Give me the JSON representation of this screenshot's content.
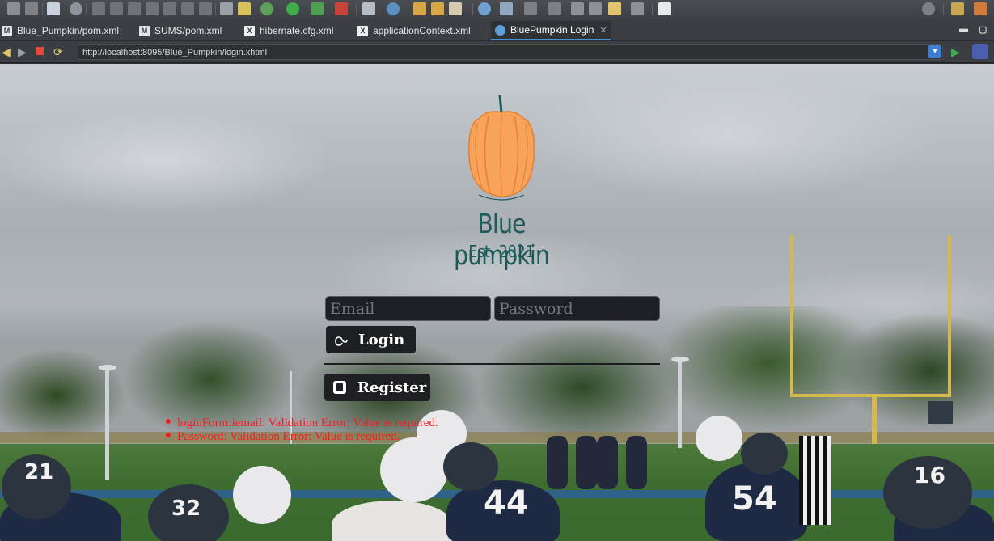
{
  "tabs": [
    {
      "label": "Blue_Pumpkin/pom.xml",
      "icon": "maven-icon",
      "active": false
    },
    {
      "label": "SUMS/pom.xml",
      "icon": "maven-icon",
      "active": false
    },
    {
      "label": "hibernate.cfg.xml",
      "icon": "xml-file-icon",
      "active": false
    },
    {
      "label": "applicationContext.xml",
      "icon": "xml-file-icon",
      "active": false
    },
    {
      "label": "BluePumpkin Login",
      "icon": "globe-icon",
      "active": true
    }
  ],
  "browser": {
    "url": "http://localhost:8095/Blue_Pumpkin/login.xhtml"
  },
  "logo": {
    "name": "Blue pumpkin",
    "est": "Est. 2021",
    "color": "#1d5a5a",
    "pumpkin_color": "#f7a35c"
  },
  "form": {
    "email_placeholder": "Email",
    "password_placeholder": "Password",
    "login_label": "Login",
    "register_label": "Register"
  },
  "errors": [
    "loginForm:iemail: Validation Error: Value is required.",
    "Password: Validation Error: Value is required."
  ],
  "players": {
    "numbers": [
      "21",
      "32",
      "44",
      "54",
      "16"
    ]
  },
  "colors": {
    "error": "#ff1a1a",
    "button_bg": "#1e1f23",
    "input_bg": "#1d1f24",
    "tab_accent": "#4a90d9"
  }
}
